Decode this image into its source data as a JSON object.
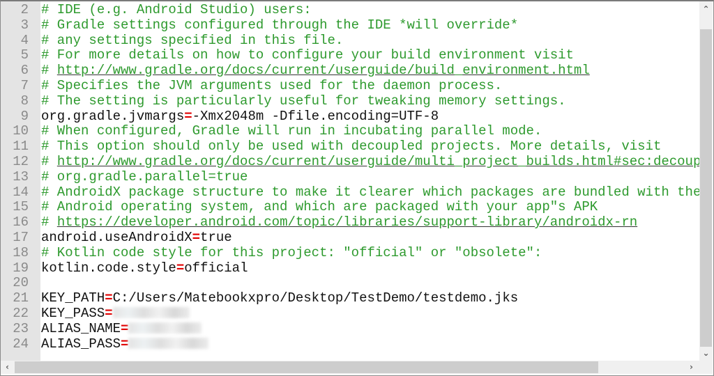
{
  "editor": {
    "lines": [
      {
        "num": "2",
        "parts": [
          {
            "t": "# IDE (e.g. Android Studio) users:",
            "c": "comment"
          }
        ]
      },
      {
        "num": "3",
        "parts": [
          {
            "t": "# Gradle settings configured through the IDE *will override*",
            "c": "comment"
          }
        ]
      },
      {
        "num": "4",
        "parts": [
          {
            "t": "# any settings specified in this file.",
            "c": "comment"
          }
        ]
      },
      {
        "num": "5",
        "parts": [
          {
            "t": "# For more details on how to configure your build environment visit",
            "c": "comment"
          }
        ]
      },
      {
        "num": "6",
        "parts": [
          {
            "t": "# ",
            "c": "comment"
          },
          {
            "t": "http://www.gradle.org/docs/current/userguide/build_environment.html",
            "c": "link"
          }
        ]
      },
      {
        "num": "7",
        "parts": [
          {
            "t": "# Specifies the JVM arguments used for the daemon process.",
            "c": "comment"
          }
        ]
      },
      {
        "num": "8",
        "parts": [
          {
            "t": "# The setting is particularly useful for tweaking memory settings.",
            "c": "comment"
          }
        ]
      },
      {
        "num": "9",
        "parts": [
          {
            "t": "org.gradle.jvmargs",
            "c": "key"
          },
          {
            "t": "=",
            "c": "eq"
          },
          {
            "t": "-Xmx2048m -Dfile.encoding=UTF-8",
            "c": "val"
          }
        ]
      },
      {
        "num": "10",
        "parts": [
          {
            "t": "# When configured, Gradle will run in incubating parallel mode.",
            "c": "comment"
          }
        ]
      },
      {
        "num": "11",
        "parts": [
          {
            "t": "# This option should only be used with decoupled projects. More details, visit",
            "c": "comment"
          }
        ]
      },
      {
        "num": "12",
        "parts": [
          {
            "t": "# ",
            "c": "comment"
          },
          {
            "t": "http://www.gradle.org/docs/current/userguide/multi_project_builds.html#sec:decoup",
            "c": "link"
          }
        ]
      },
      {
        "num": "13",
        "parts": [
          {
            "t": "# org.gradle.parallel=true",
            "c": "comment"
          }
        ]
      },
      {
        "num": "14",
        "parts": [
          {
            "t": "# AndroidX package structure to make it clearer which packages are bundled with the",
            "c": "comment"
          }
        ]
      },
      {
        "num": "15",
        "parts": [
          {
            "t": "# Android operating system, and which are packaged with your app\"s APK",
            "c": "comment"
          }
        ]
      },
      {
        "num": "16",
        "parts": [
          {
            "t": "# ",
            "c": "comment"
          },
          {
            "t": "https://developer.android.com/topic/libraries/support-library/androidx-rn",
            "c": "link"
          }
        ]
      },
      {
        "num": "17",
        "parts": [
          {
            "t": "android.useAndroidX",
            "c": "key"
          },
          {
            "t": "=",
            "c": "eq"
          },
          {
            "t": "true",
            "c": "val"
          }
        ]
      },
      {
        "num": "18",
        "parts": [
          {
            "t": "# Kotlin code style for this project: \"official\" or \"obsolete\":",
            "c": "comment"
          }
        ]
      },
      {
        "num": "19",
        "parts": [
          {
            "t": "kotlin.code.style",
            "c": "key"
          },
          {
            "t": "=",
            "c": "eq"
          },
          {
            "t": "official",
            "c": "val"
          }
        ]
      },
      {
        "num": "20",
        "parts": []
      },
      {
        "num": "21",
        "parts": [
          {
            "t": "KEY_PATH",
            "c": "key"
          },
          {
            "t": "=",
            "c": "eq"
          },
          {
            "t": "C:/Users/Matebookxpro/Desktop/TestDemo/testdemo.jks",
            "c": "val"
          }
        ]
      },
      {
        "num": "22",
        "parts": [
          {
            "t": "KEY_PASS",
            "c": "key"
          },
          {
            "t": "=",
            "c": "eq"
          },
          {
            "t": "",
            "c": "blur",
            "w": 110
          }
        ]
      },
      {
        "num": "23",
        "parts": [
          {
            "t": "ALIAS_NAME",
            "c": "key"
          },
          {
            "t": "=",
            "c": "eq"
          },
          {
            "t": "",
            "c": "blur",
            "w": 105
          }
        ]
      },
      {
        "num": "24",
        "parts": [
          {
            "t": "ALIAS_PASS",
            "c": "key"
          },
          {
            "t": "=",
            "c": "eq"
          },
          {
            "t": "",
            "c": "blur",
            "w": 115
          }
        ]
      }
    ]
  },
  "scrollbars": {
    "up_icon": "chevron-up",
    "down_icon": "chevron-down",
    "left_icon": "chevron-left",
    "right_icon": "chevron-right"
  }
}
